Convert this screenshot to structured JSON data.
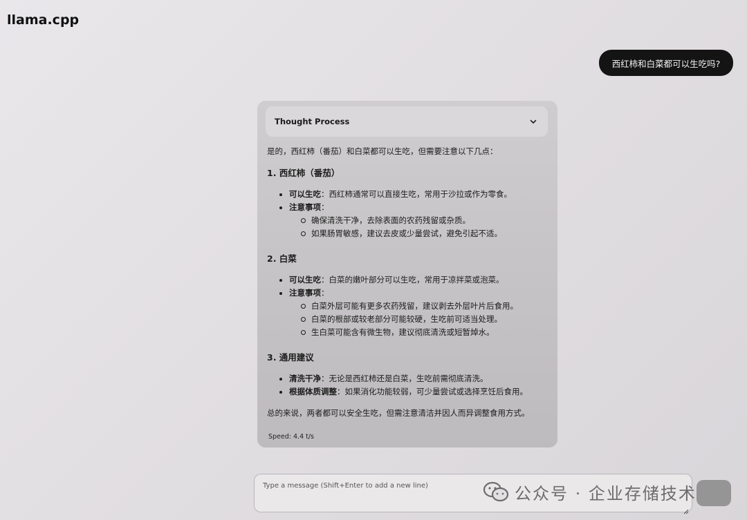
{
  "app": {
    "title": "llama.cpp"
  },
  "user_message": "西红柿和白菜都可以生吃吗?",
  "assistant": {
    "thought_label": "Thought Process",
    "intro": "是的，西红柿（番茄）和白菜都可以生吃，但需要注意以下几点：",
    "section1": {
      "heading": "1. 西红柿（番茄）",
      "item1_label": "可以生吃",
      "item1_text": "：西红柿通常可以直接生吃，常用于沙拉或作为零食。",
      "item2_label": "注意事项",
      "item2_text": "：",
      "sub1": "确保清洗干净，去除表面的农药残留或杂质。",
      "sub2": "如果肠胃敏感，建议去皮或少量尝试，避免引起不适。"
    },
    "section2": {
      "heading": "2. 白菜",
      "item1_label": "可以生吃",
      "item1_text": "：白菜的嫩叶部分可以生吃，常用于凉拌菜或泡菜。",
      "item2_label": "注意事项",
      "item2_text": "：",
      "sub1": "白菜外层可能有更多农药残留，建议剥去外层叶片后食用。",
      "sub2": "白菜的根部或较老部分可能较硬，生吃前可适当处理。",
      "sub3": "生白菜可能含有微生物，建议彻底清洗或短暂焯水。"
    },
    "section3": {
      "heading": "3. 通用建议",
      "item1_label": "清洗干净",
      "item1_text": "：无论是西红柿还是白菜，生吃前需彻底清洗。",
      "item2_label": "根据体质调整",
      "item2_text": "：如果消化功能较弱，可少量尝试或选择烹饪后食用。"
    },
    "conclusion": "总的来说，两者都可以安全生吃，但需注意清洁并因人而异调整食用方式。",
    "speed": "Speed: 4.4 t/s"
  },
  "input": {
    "placeholder": "Type a message (Shift+Enter to add a new line)"
  },
  "watermark": {
    "text": "公众号 · 企业存储技术"
  },
  "icons": {
    "thought_toggle": "chevron-down-icon",
    "watermark": "wechat-icon",
    "resize": "resize-handle-icon"
  }
}
